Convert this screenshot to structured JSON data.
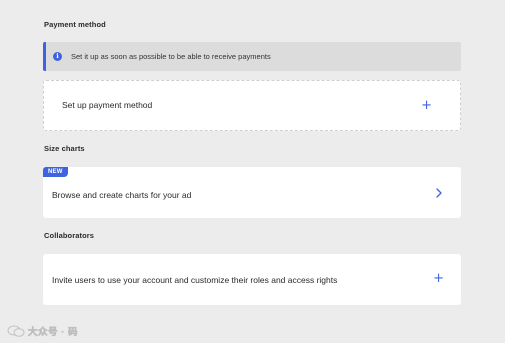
{
  "payment": {
    "title": "Payment method",
    "info_icon": "info-icon",
    "info_text": "Set it up as soon as possible to be able to receive payments",
    "setup_label": "Set up payment method",
    "setup_icon": "plus-icon"
  },
  "size_charts": {
    "title": "Size charts",
    "badge": "NEW",
    "browse_label": "Browse and create charts for your ad",
    "browse_icon": "chevron-right-icon"
  },
  "collaborators": {
    "title": "Collaborators",
    "invite_label": "Invite users to use your account and customize their roles and access rights",
    "invite_icon": "plus-icon"
  },
  "watermark": {
    "text": "大众号 · 码"
  },
  "colors": {
    "accent": "#3f62e3",
    "page_background": "#ececec",
    "banner_background": "#dcdcdc",
    "card_background": "#ffffff"
  }
}
